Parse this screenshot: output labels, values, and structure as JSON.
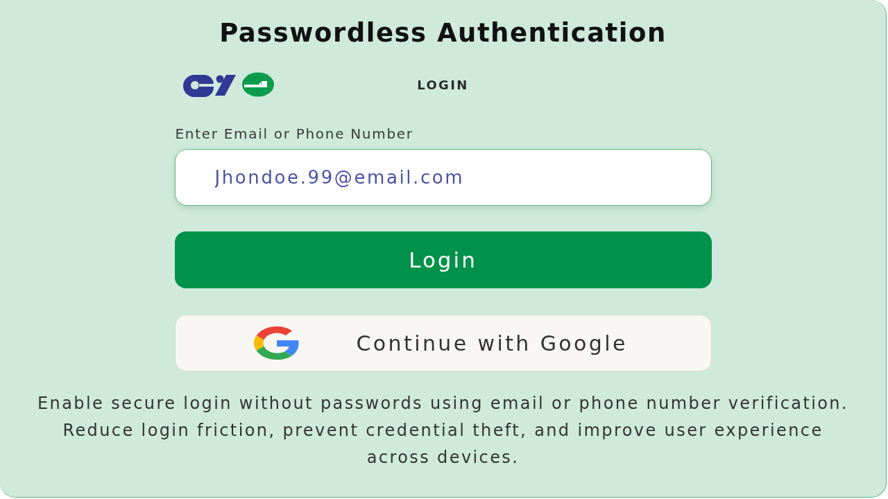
{
  "title": "Passwordless Authentication",
  "heading": "LOGIN",
  "form": {
    "label": "Enter Email or Phone Number",
    "value": "Jhondoe.99@email.com"
  },
  "buttons": [
    {
      "kind": "primary",
      "label": "Login"
    },
    {
      "kind": "google",
      "label": "Continue with Google"
    }
  ],
  "description": "Enable secure login without passwords using email or phone number verification. Reduce login friction, prevent credential theft, and improve user experience across devices."
}
